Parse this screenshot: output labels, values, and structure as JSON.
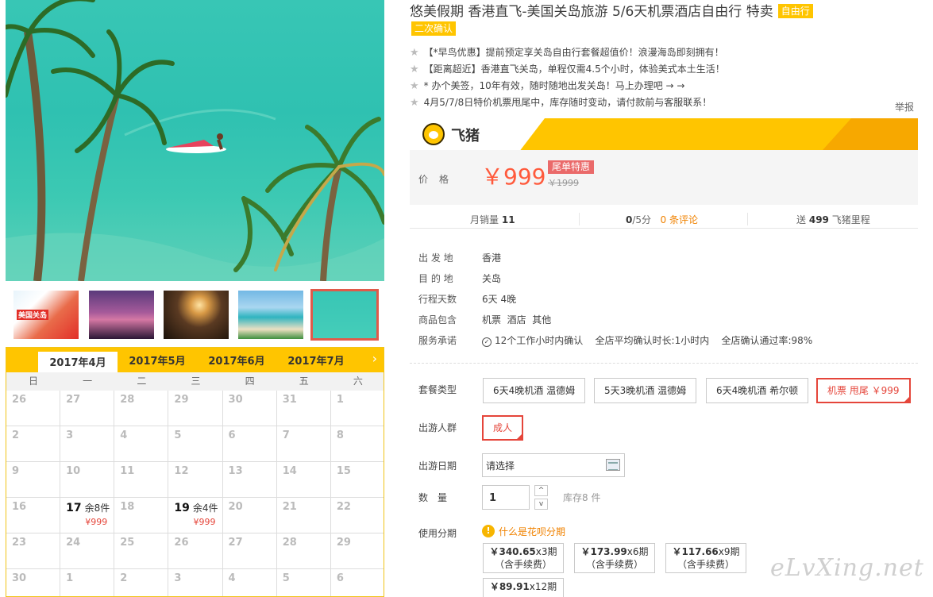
{
  "title": "悠美假期 香港直飞-美国关岛旅游 5/6天机票酒店自由行 特卖",
  "tag_free": "自由行",
  "tag_confirm": "二次确认",
  "features": [
    "【*早鸟优惠】提前预定享关岛自由行套餐超值价！浪漫海岛即刻拥有！",
    "【距离超近】香港直飞关岛，单程仅需4.5个小时，体验美式本土生活！",
    "* 办个美签，10年有效，随时随地出发关岛！马上办理吧 → →",
    "4月5/7/8日特价机票甩尾中，库存随时变动，请付款前与客服联系！"
  ],
  "report_label": "举报",
  "brand_name": "飞猪",
  "price": {
    "label": "价格",
    "current": "￥999",
    "badge": "尾单特惠",
    "original": "￥1999"
  },
  "stats": {
    "monthly_label": "月销量",
    "monthly_value": "11",
    "score_value": "0",
    "score_suffix": "/5分",
    "reviews": "0 条评论",
    "miles_prefix": "送",
    "miles_value": "499",
    "miles_suffix": "飞猪里程"
  },
  "info": [
    {
      "k": "出 发 地",
      "v": "香港"
    },
    {
      "k": "目 的 地",
      "v": "关岛"
    },
    {
      "k": "行程天数",
      "v": "6天 4晚"
    },
    {
      "k": "商品包含",
      "v": "机票  酒店  其他"
    }
  ],
  "service": {
    "k": "服务承诺",
    "v1": "12个工作小时内确认",
    "v2": "全店平均确认时长:1小时内",
    "v3": "全店确认通过率:98%"
  },
  "package_label": "套餐类型",
  "packages": [
    "6天4晚机酒 温德姆",
    "5天3晚机酒 温德姆",
    "6天4晚机酒 希尔顿",
    "机票 甩尾 ￥999"
  ],
  "crowd_label": "出游人群",
  "crowd_value": "成人",
  "date_label": "出游日期",
  "date_placeholder": "请选择",
  "qty_label": "数　量",
  "qty_value": "1",
  "spin_up": "^",
  "spin_down": "v",
  "stock": "库存8 件",
  "installment_label": "使用分期",
  "huabei_link": "什么是花呗分期",
  "huabei_icon": "!",
  "installments": [
    {
      "amount": "￥340.65",
      "period": "x3期",
      "note": "（含手续费）"
    },
    {
      "amount": "￥173.99",
      "period": "x6期",
      "note": "（含手续费）"
    },
    {
      "amount": "￥117.66",
      "period": "x9期",
      "note": "（含手续费）"
    },
    {
      "amount": "￥89.91",
      "period": "x12期",
      "note": ""
    }
  ],
  "thumb_caption": "美国关岛",
  "calendar": {
    "months": [
      "2017年4月",
      "2017年5月",
      "2017年6月",
      "2017年7月"
    ],
    "next_arrow": "›",
    "weekdays": [
      "日",
      "一",
      "二",
      "三",
      "四",
      "五",
      "六"
    ],
    "rows": [
      [
        {
          "d": "26"
        },
        {
          "d": "27"
        },
        {
          "d": "28"
        },
        {
          "d": "29"
        },
        {
          "d": "30"
        },
        {
          "d": "31"
        },
        {
          "d": "1"
        }
      ],
      [
        {
          "d": "2"
        },
        {
          "d": "3"
        },
        {
          "d": "4"
        },
        {
          "d": "5"
        },
        {
          "d": "6"
        },
        {
          "d": "7"
        },
        {
          "d": "8"
        }
      ],
      [
        {
          "d": "9"
        },
        {
          "d": "10"
        },
        {
          "d": "11"
        },
        {
          "d": "12"
        },
        {
          "d": "13"
        },
        {
          "d": "14"
        },
        {
          "d": "15"
        }
      ],
      [
        {
          "d": "16"
        },
        {
          "d": "17",
          "rem": "余8件",
          "price": "¥999"
        },
        {
          "d": "18"
        },
        {
          "d": "19",
          "rem": "余4件",
          "price": "¥999"
        },
        {
          "d": "20"
        },
        {
          "d": "21"
        },
        {
          "d": "22"
        }
      ],
      [
        {
          "d": "23"
        },
        {
          "d": "24"
        },
        {
          "d": "25"
        },
        {
          "d": "26"
        },
        {
          "d": "27"
        },
        {
          "d": "28"
        },
        {
          "d": "29"
        }
      ],
      [
        {
          "d": "30"
        },
        {
          "d": "1"
        },
        {
          "d": "2"
        },
        {
          "d": "3"
        },
        {
          "d": "4"
        },
        {
          "d": "5"
        },
        {
          "d": "6"
        }
      ]
    ]
  },
  "watermark": "eLvXing.net",
  "colors": {
    "accent": "#ffc500",
    "price": "#ff5a3c",
    "selected": "#e5453a"
  }
}
